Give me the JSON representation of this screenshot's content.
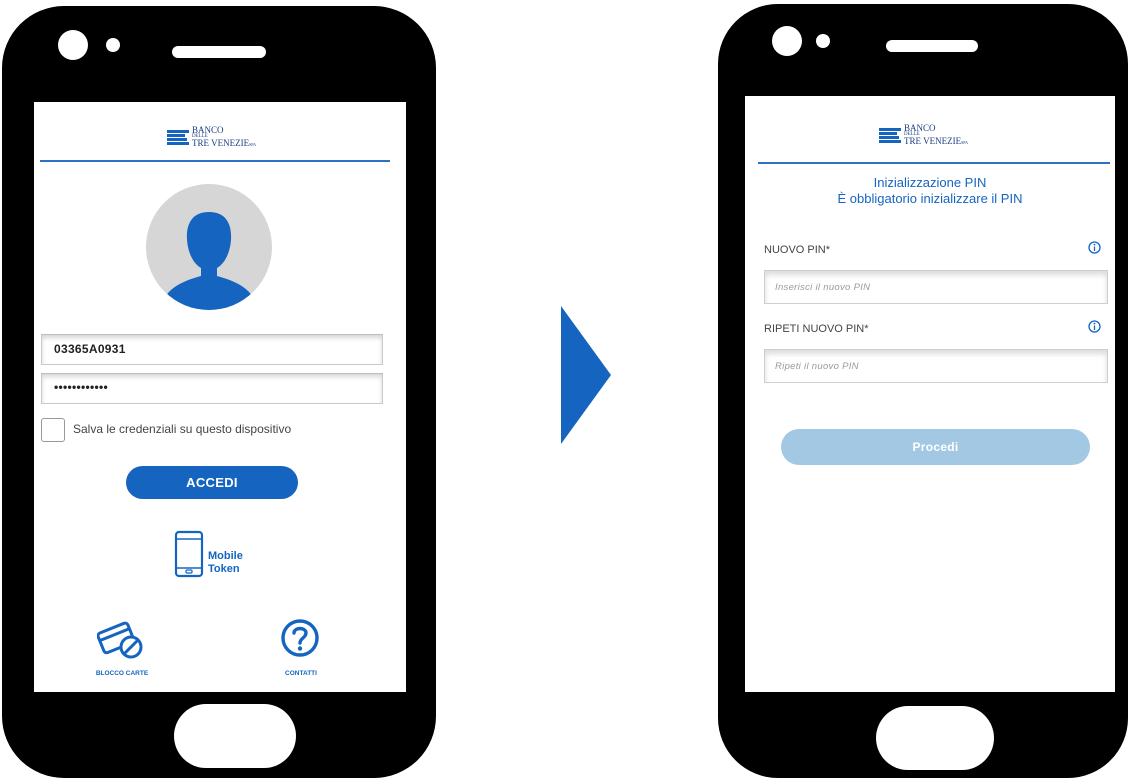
{
  "colors": {
    "brand_blue": "#1565c0",
    "disabled_button": "#a2c8e4",
    "phone_body": "#000000",
    "avatar_bg": "#d6d6d6"
  },
  "logo": {
    "line1": "BANCO",
    "line2": "DELLE",
    "line3": "TRE VENEZIE",
    "line3_suffix": "SPA"
  },
  "login_screen": {
    "username_value": "03365A0931",
    "password_value": "••••••••••••",
    "save_credentials_label": "Salva le credenziali su questo dispositivo",
    "save_credentials_checked": false,
    "login_button": "ACCEDI",
    "mobile_token_line1": "Mobile",
    "mobile_token_line2": "Token",
    "card_block_label": "BLOCCO CARTE",
    "contacts_label": "CONTATTI",
    "icons": [
      "user-avatar-icon",
      "mobile-phone-icon",
      "card-block-icon",
      "help-question-icon"
    ]
  },
  "transition": {
    "icon": "arrow-right-icon"
  },
  "pin_screen": {
    "title_line1": "Inizializzazione PIN",
    "title_line2": "È obbligatorio inizializzare il PIN",
    "new_pin_label": "NUOVO PIN*",
    "new_pin_placeholder": "Inserisci il nuovo PIN",
    "repeat_pin_label": "RIPETI NUOVO PIN*",
    "repeat_pin_placeholder": "Ripeti il nuovo PIN",
    "submit_button": "Procedi",
    "submit_enabled": false,
    "icons": [
      "info-icon"
    ]
  }
}
